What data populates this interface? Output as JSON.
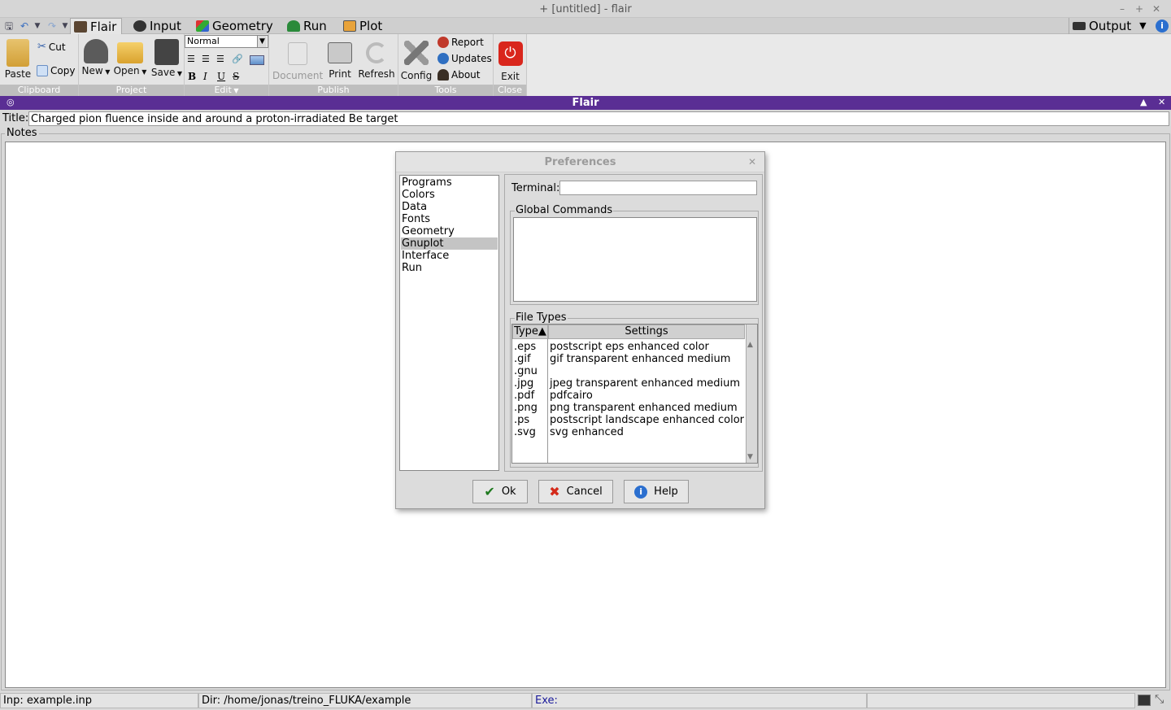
{
  "window": {
    "title": "+ [untitled] - flair"
  },
  "tabs": [
    {
      "label": "Flair",
      "icon": "flair-icon",
      "active": true
    },
    {
      "label": "Input",
      "icon": "input-icon"
    },
    {
      "label": "Geometry",
      "icon": "geometry-icon"
    },
    {
      "label": "Run",
      "icon": "run-icon"
    },
    {
      "label": "Plot",
      "icon": "plot-icon"
    }
  ],
  "output": {
    "label": "Output"
  },
  "ribbon": {
    "clipboard": {
      "label": "Clipboard",
      "paste": "Paste",
      "cut": "Cut",
      "copy": "Copy"
    },
    "project": {
      "label": "Project",
      "new": "New",
      "open": "Open",
      "save": "Save"
    },
    "edit": {
      "label": "Edit",
      "style": "Normal"
    },
    "publish": {
      "label": "Publish",
      "document": "Document",
      "print": "Print",
      "refresh": "Refresh"
    },
    "tools": {
      "label": "Tools",
      "config": "Config",
      "report": "Report",
      "updates": "Updates",
      "about": "About"
    },
    "close": {
      "label": "Close",
      "exit": "Exit"
    }
  },
  "flairbar": {
    "title": "Flair"
  },
  "project_title": {
    "label": "Title:",
    "value": "Charged pion fluence inside and around a proton-irradiated Be target"
  },
  "notes": {
    "label": "Notes"
  },
  "preferences": {
    "title": "Preferences",
    "categories": [
      "Programs",
      "Colors",
      "Data",
      "Fonts",
      "Geometry",
      "Gnuplot",
      "Interface",
      "Run"
    ],
    "selected": "Gnuplot",
    "terminal_label": "Terminal:",
    "terminal_value": "",
    "global_commands_label": "Global Commands",
    "file_types_label": "File Types",
    "columns": {
      "type": "Type▲",
      "settings": "Settings"
    },
    "file_types": [
      {
        "type": ".eps",
        "settings": "postscript eps enhanced color"
      },
      {
        "type": ".gif",
        "settings": "gif transparent enhanced medium"
      },
      {
        "type": ".gnu",
        "settings": ""
      },
      {
        "type": ".jpg",
        "settings": "jpeg transparent enhanced medium"
      },
      {
        "type": ".pdf",
        "settings": "pdfcairo"
      },
      {
        "type": ".png",
        "settings": "png transparent enhanced medium"
      },
      {
        "type": ".ps",
        "settings": "postscript landscape enhanced color"
      },
      {
        "type": ".svg",
        "settings": "svg enhanced"
      }
    ],
    "buttons": {
      "ok": "Ok",
      "cancel": "Cancel",
      "help": "Help"
    }
  },
  "status": {
    "inp": "Inp: example.inp",
    "dir": "Dir: /home/jonas/treino_FLUKA/example",
    "exe": "Exe:"
  }
}
